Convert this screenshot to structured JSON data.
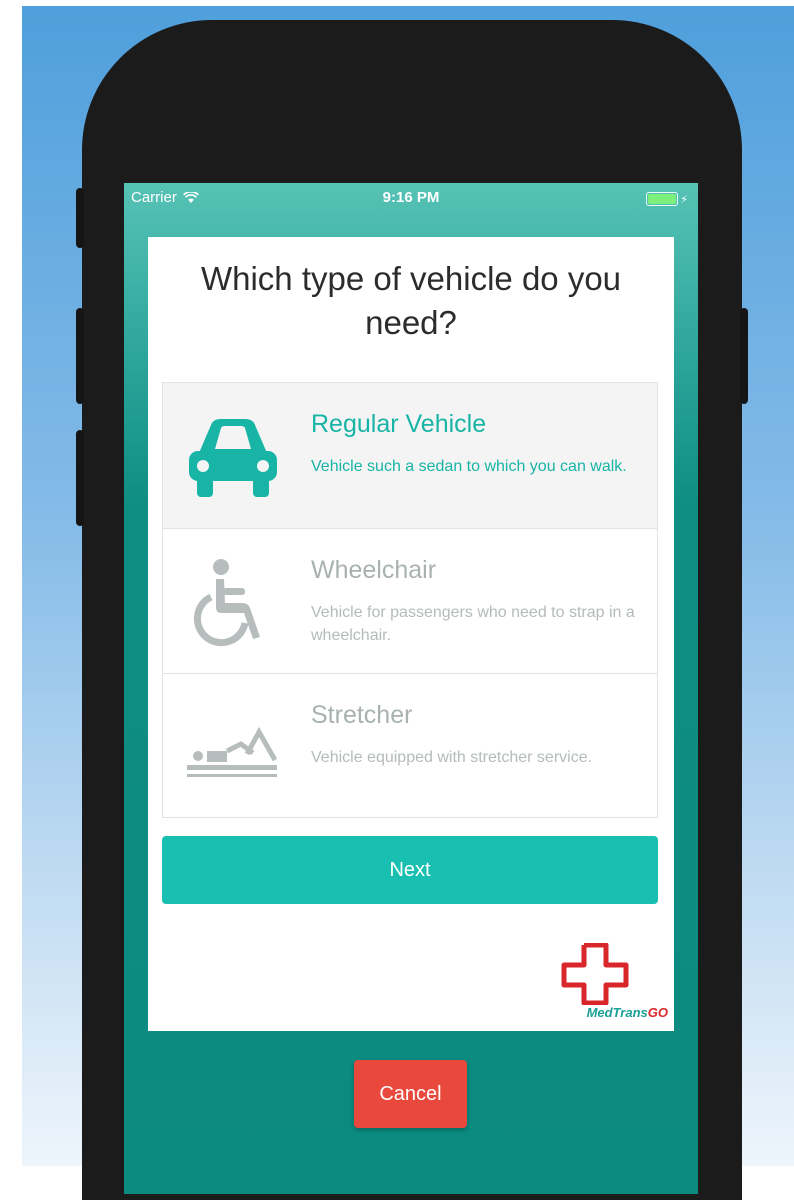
{
  "status_bar": {
    "carrier": "Carrier",
    "time": "9:16 PM"
  },
  "dialog": {
    "title": "Which type of vehicle do you need?"
  },
  "options": [
    {
      "name": "Regular Vehicle",
      "description": "Vehicle such a sedan to which you can walk.",
      "icon": "car-icon",
      "selected": true
    },
    {
      "name": "Wheelchair",
      "description": "Vehicle for passengers who need to strap in a wheelchair.",
      "icon": "wheelchair-icon",
      "selected": false
    },
    {
      "name": "Stretcher",
      "description": "Vehicle equipped with stretcher service.",
      "icon": "stretcher-icon",
      "selected": false
    }
  ],
  "actions": {
    "next_label": "Next",
    "cancel_label": "Cancel"
  },
  "logo": {
    "brand_main": "MedTrans",
    "brand_accent": "GO"
  },
  "colors": {
    "accent": "#19bfb1",
    "cancel": "#e8493c",
    "logo_red": "#d9262b",
    "dim_text": "#a9b1b1"
  }
}
